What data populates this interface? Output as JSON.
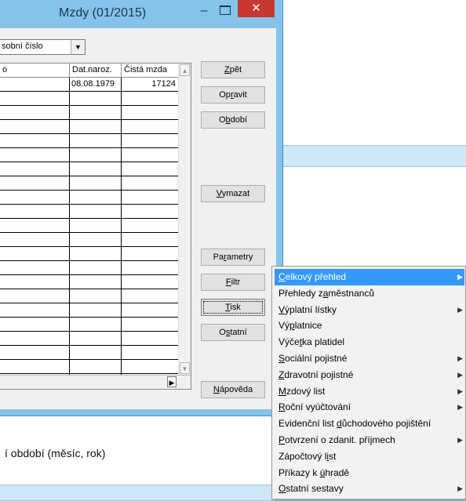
{
  "window": {
    "title": "Mzdy (01/2015)",
    "minimize": "–",
    "close": "✕"
  },
  "combo": {
    "value": "sobní číslo",
    "arrow": "▼"
  },
  "grid": {
    "headers": [
      "o",
      "Dat.naroz.",
      "Čistá mzda"
    ],
    "rows": [
      [
        "",
        "08.08.1979",
        "17124"
      ]
    ],
    "empty_rows": 21,
    "scroll_up": "▲",
    "scroll_down": "▼",
    "hscroll_right": "▶"
  },
  "buttons": {
    "zpet_pre": "",
    "zpet_ul": "Z",
    "zpet_post": "pět",
    "opravit_pre": "Op",
    "opravit_ul": "r",
    "opravit_post": "avit",
    "obdobi_pre": "O",
    "obdobi_ul": "b",
    "obdobi_post": "dobí",
    "vymazat_pre": "",
    "vymazat_ul": "V",
    "vymazat_post": "ymazat",
    "parametry_pre": "Pa",
    "parametry_ul": "r",
    "parametry_post": "ametry",
    "filtr_pre": "",
    "filtr_ul": "F",
    "filtr_post": "iltr",
    "tisk_pre": "",
    "tisk_ul": "T",
    "tisk_post": "isk",
    "ostatni_pre": "O",
    "ostatni_ul": "s",
    "ostatni_post": "tatní",
    "napoveda_pre": "",
    "napoveda_ul": "N",
    "napoveda_post": "ápověda"
  },
  "background": {
    "period_text": "í období (měsíc, rok)"
  },
  "menu": {
    "items": [
      {
        "pre": "",
        "ul": "C",
        "post": "elkový přehled",
        "submenu": true,
        "selected": true
      },
      {
        "pre": "Přehledy z",
        "ul": "a",
        "post": "městnanců",
        "submenu": false
      },
      {
        "pre": "",
        "ul": "V",
        "post": "ýplatní lístky",
        "submenu": true
      },
      {
        "pre": "Vý",
        "ul": "p",
        "post": "latnice",
        "submenu": false
      },
      {
        "pre": "Výče",
        "ul": "t",
        "post": "ka platidel",
        "submenu": false
      },
      {
        "pre": "",
        "ul": "S",
        "post": "ociální pojistné",
        "submenu": true
      },
      {
        "pre": "",
        "ul": "Z",
        "post": "dravotní pojistné",
        "submenu": true
      },
      {
        "pre": "",
        "ul": "M",
        "post": "zdový list",
        "submenu": true
      },
      {
        "pre": "",
        "ul": "R",
        "post": "oční vyúčtování",
        "submenu": true
      },
      {
        "pre": "Evidenční list ",
        "ul": "d",
        "post": "ůchodového pojištění",
        "submenu": false
      },
      {
        "pre": "",
        "ul": "P",
        "post": "otvrzení o zdanit. příjmech",
        "submenu": true
      },
      {
        "pre": "Zápočtový l",
        "ul": "i",
        "post": "st",
        "submenu": false
      },
      {
        "pre": "Příkazy k ",
        "ul": "ú",
        "post": "hradě",
        "submenu": false
      },
      {
        "pre": "",
        "ul": "O",
        "post": "statní sestavy",
        "submenu": true
      }
    ],
    "arrow": "▶"
  },
  "colors": {
    "titlebar": "#86c3ea",
    "close": "#c7372f",
    "selection": "#3399ff"
  }
}
